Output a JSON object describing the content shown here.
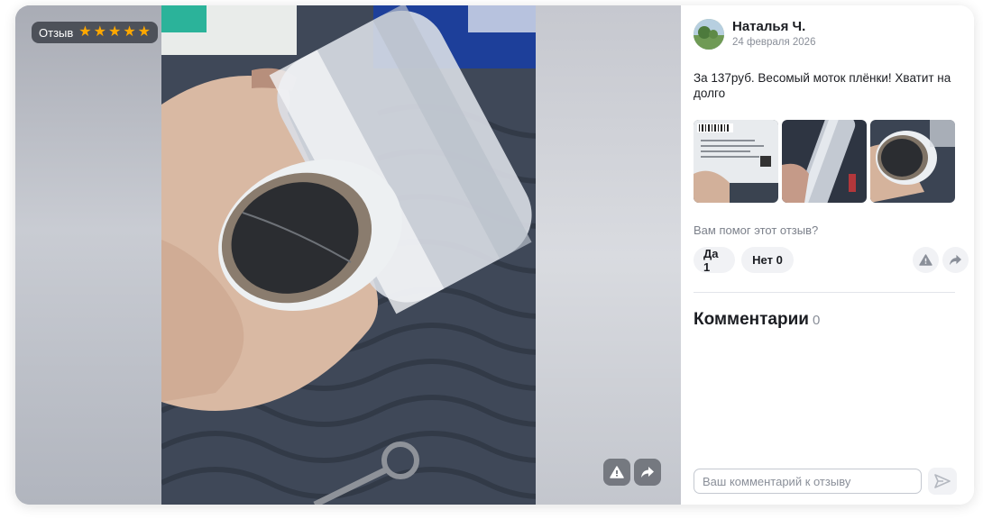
{
  "review": {
    "badge_label": "Отзыв",
    "rating": 5,
    "author": "Наталья Ч.",
    "date": "24 февраля 2026",
    "text": "За 137руб. Весомый моток плёнки! Хватит на долго",
    "photos": [
      "photo-1",
      "photo-2",
      "photo-3"
    ]
  },
  "helpful": {
    "question": "Вам помог этот отзыв?",
    "yes_label": "Да 1",
    "no_label": "Нет 0"
  },
  "comments": {
    "title": "Комментарии",
    "count": "0",
    "input_placeholder": "Ваш комментарий к отзыву"
  },
  "icons": {
    "report": "warning-triangle-icon",
    "share": "share-arrow-icon",
    "send": "send-icon",
    "star": "star-icon"
  },
  "colors": {
    "star": "#ffa800",
    "text": "#1b1d22",
    "muted": "#8a8f99",
    "button_bg": "#f1f2f5"
  }
}
